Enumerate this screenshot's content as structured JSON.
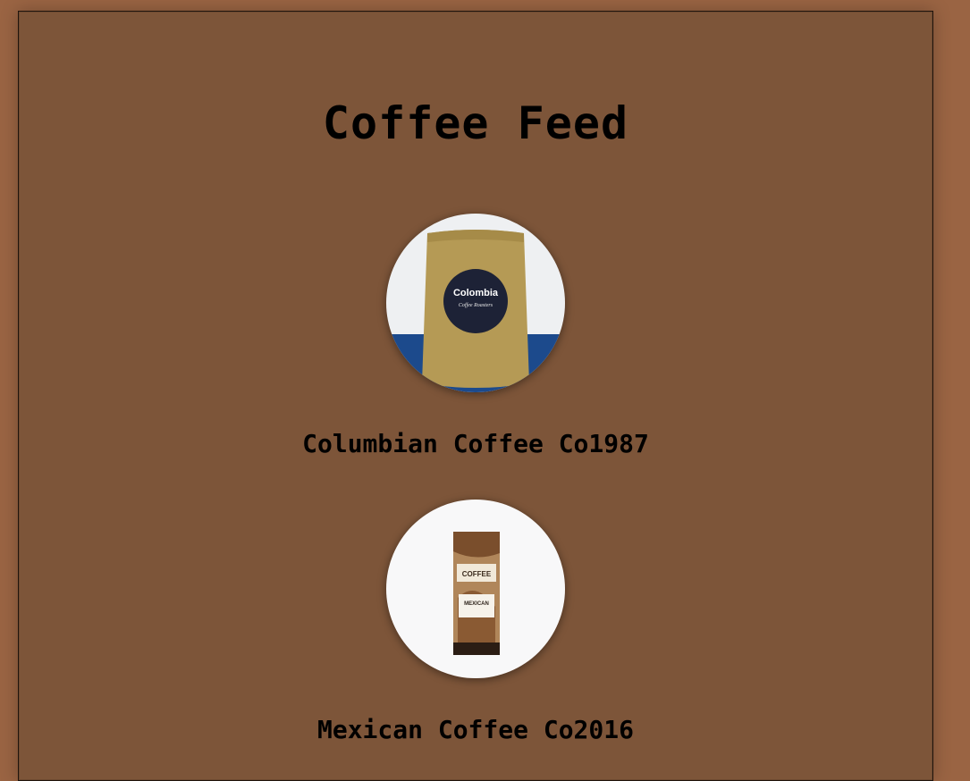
{
  "feed": {
    "title": "Coffee Feed",
    "items": [
      {
        "name": "Columbian Coffee Co1987",
        "image_icon": "coffee-bag-colombia-icon",
        "bag_label_main": "Colombia",
        "bag_label_sub": "Coffee Roasters"
      },
      {
        "name": "Mexican Coffee Co2016",
        "image_icon": "coffee-bag-mexican-icon",
        "bag_label_main": "COFFEE",
        "bag_label_sub": "MEXICAN"
      }
    ]
  },
  "colors": {
    "page_bg": "#9a6443",
    "panel_bg": "#7d5539",
    "text": "#000000"
  }
}
